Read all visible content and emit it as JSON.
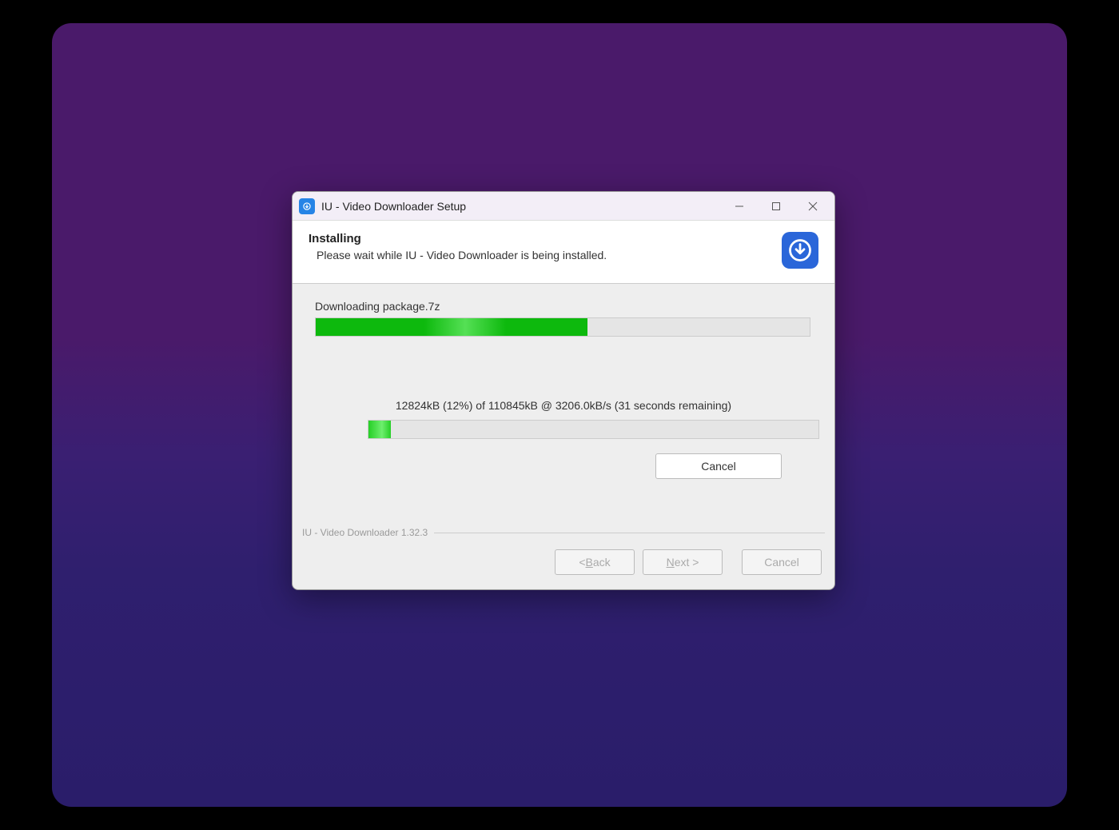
{
  "titlebar": {
    "title": "IU - Video Downloader Setup"
  },
  "header": {
    "title": "Installing",
    "subtitle": "Please wait while IU - Video Downloader is being installed."
  },
  "progress": {
    "task_label": "Downloading package.7z",
    "main_percent": 55,
    "detail_status": "12824kB (12%) of 110845kB @ 3206.0kB/s (31 seconds remaining)",
    "detail_percent": 5,
    "cancel_label": "Cancel"
  },
  "footer": {
    "brand": "IU - Video Downloader 1.32.3",
    "back_label": "< Back",
    "next_label": "Next >",
    "cancel_label": "Cancel"
  }
}
